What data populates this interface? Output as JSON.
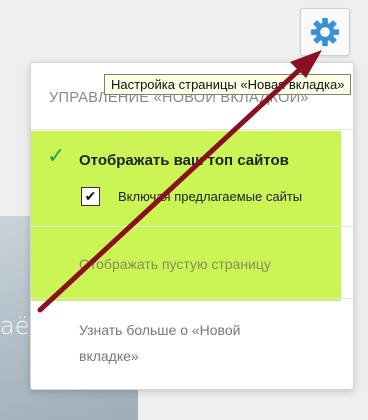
{
  "background": {
    "partial_text": "аё"
  },
  "gear_button": {
    "icon": "gear-icon",
    "color": "#3a8fd9"
  },
  "tooltip": {
    "text": "Настройка страницы «Новая вкладка»"
  },
  "popup": {
    "header": "Управление «Новой вкладкой»",
    "options": {
      "show_top_sites": "Отображать ваш топ сайтов",
      "include_suggested": "Включая предлагаемые сайты",
      "include_suggested_checked": true,
      "show_blank_page": "Отображать пустую страницу",
      "learn_more": "Узнать больше о «Новой вкладке»"
    }
  },
  "annotation": {
    "highlight_color": "#c4f23e",
    "arrow_color": "#8a1020"
  }
}
